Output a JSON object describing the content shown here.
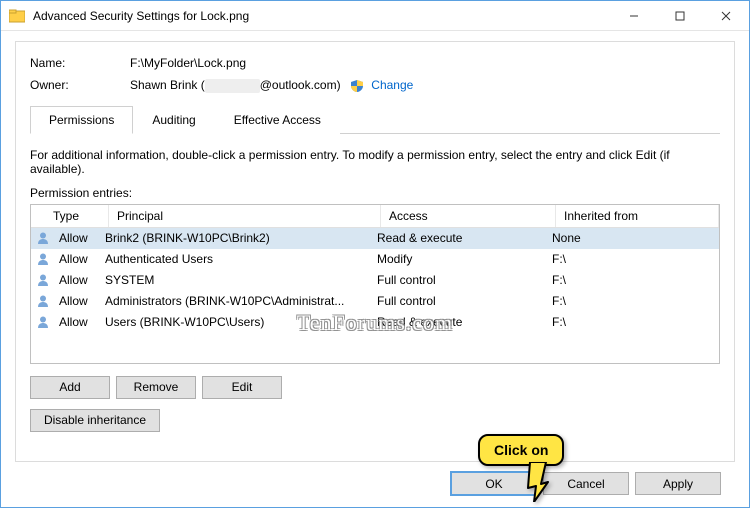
{
  "window": {
    "title": "Advanced Security Settings for Lock.png"
  },
  "header": {
    "name_label": "Name:",
    "name_value": "F:\\MyFolder\\Lock.png",
    "owner_label": "Owner:",
    "owner_value_pre": "Shawn Brink",
    "owner_value_post": "@outlook.com)",
    "change": "Change"
  },
  "tabs": {
    "permissions": "Permissions",
    "auditing": "Auditing",
    "effective": "Effective Access"
  },
  "info": "For additional information, double-click a permission entry. To modify a permission entry, select the entry and click Edit (if available).",
  "list_label": "Permission entries:",
  "columns": {
    "type": "Type",
    "principal": "Principal",
    "access": "Access",
    "inherited": "Inherited from"
  },
  "rows": [
    {
      "type": "Allow",
      "principal": "Brink2 (BRINK-W10PC\\Brink2)",
      "access": "Read & execute",
      "inherited": "None",
      "selected": true
    },
    {
      "type": "Allow",
      "principal": "Authenticated Users",
      "access": "Modify",
      "inherited": "F:\\",
      "selected": false
    },
    {
      "type": "Allow",
      "principal": "SYSTEM",
      "access": "Full control",
      "inherited": "F:\\",
      "selected": false
    },
    {
      "type": "Allow",
      "principal": "Administrators (BRINK-W10PC\\Administrat...",
      "access": "Full control",
      "inherited": "F:\\",
      "selected": false
    },
    {
      "type": "Allow",
      "principal": "Users (BRINK-W10PC\\Users)",
      "access": "Read & execute",
      "inherited": "F:\\",
      "selected": false
    }
  ],
  "buttons": {
    "add": "Add",
    "remove": "Remove",
    "edit": "Edit",
    "disable": "Disable inheritance",
    "ok": "OK",
    "cancel": "Cancel",
    "apply": "Apply"
  },
  "callout": "Click on",
  "watermark": "TenForums.com"
}
